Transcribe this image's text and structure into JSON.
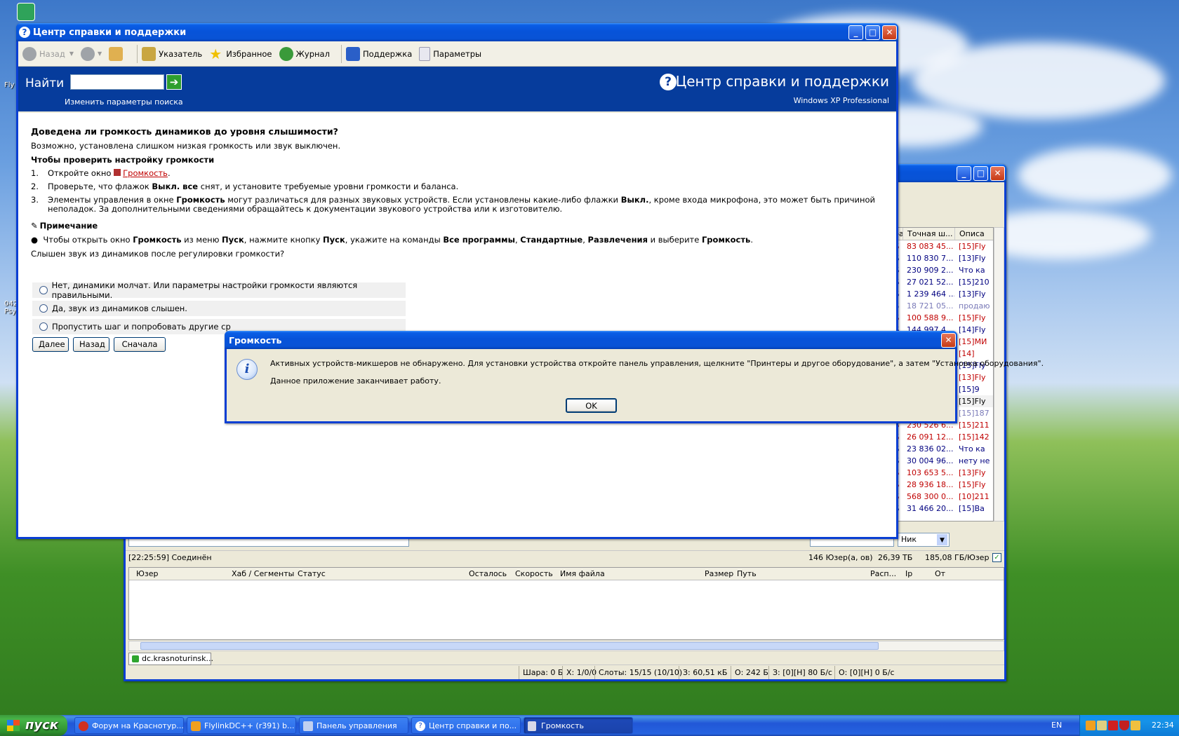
{
  "desktop": {
    "icons": [
      "Fly",
      "042\nPsy"
    ]
  },
  "help_window": {
    "title": "Центр справки и поддержки",
    "toolbar": {
      "back": "Назад",
      "index": "Указатель",
      "favorites": "Избранное",
      "history": "Журнал",
      "support": "Поддержка",
      "options": "Параметры"
    },
    "search": {
      "label": "Найти",
      "value": "",
      "change_params": "Изменить параметры поиска"
    },
    "banner": {
      "title": "Центр справки и поддержки",
      "subtitle": "Windows XP Professional"
    },
    "content": {
      "heading": "Доведена ли громкость динамиков до уровня слышимости?",
      "intro": "Возможно, установлена слишком низкая громкость или звук выключен.",
      "subheading": "Чтобы проверить настройку громкости",
      "step1_num": "1.",
      "step1_pre": "Откройте окно ",
      "step1_link": "Громкость",
      "step1_post": ".",
      "step2_num": "2.",
      "step2_pre": "Проверьте, что флажок ",
      "step2_bold": "Выкл. все",
      "step2_post": " снят, и установите требуемые уровни громкости и баланса.",
      "step3_num": "3.",
      "step3_a": "Элементы управления в окне ",
      "step3_b": "Громкость",
      "step3_c": " могут различаться для разных звуковых устройств. Если установлены какие-либо флажки ",
      "step3_d": "Выкл.",
      "step3_e": ", кроме входа микрофона, это может быть причиной неполадок. За дополнительными сведениями обращайтесь к документации звукового устройства или к изготовителю.",
      "note_title": "Примечание",
      "note_a": "Чтобы открыть окно ",
      "note_b": "Громкость",
      "note_c": " из меню ",
      "note_d": "Пуск",
      "note_e": ", нажмите кнопку ",
      "note_f": "Пуск",
      "note_g": ", укажите на команды ",
      "note_h": "Все программы",
      "note_i": ", ",
      "note_j": "Стандартные",
      "note_k": ", ",
      "note_l": "Развлечения",
      "note_m": " и выберите ",
      "note_n": "Громкость",
      "note_o": ".",
      "question": "Слышен звук из динамиков после регулировки громкости?",
      "options": [
        "Нет, динамики молчат. Или параметры настройки громкости являются правильными.",
        "Да, звук из динамиков слышен.",
        "Пропустить шаг и попробовать другие ср"
      ],
      "buttons": {
        "next": "Далее",
        "back": "Назад",
        "restart": "Сначала"
      }
    }
  },
  "dc_window": {
    "columns_top": [
      "ра",
      "Точная ш...",
      "Описа"
    ],
    "rows": [
      {
        "a": "Б",
        "b": "83 083 45...",
        "c": "[15]Fly",
        "color": "#c00000"
      },
      {
        "a": "Б",
        "b": "110 830 7...",
        "c": "[13]Fly",
        "color": "#000080"
      },
      {
        "a": "Б",
        "b": "230 909 2...",
        "c": "Что ка",
        "color": "#000080"
      },
      {
        "a": "Б",
        "b": "27 021 52...",
        "c": "[15]210",
        "color": "#000080"
      },
      {
        "a": "Б",
        "b": "1 239 464 ...",
        "c": "[13]Fly",
        "color": "#000080"
      },
      {
        "a": "Б",
        "b": "18 721 05...",
        "c": "продаю",
        "color": "#7a7ab8"
      },
      {
        "a": "Б",
        "b": "100 588 9...",
        "c": "[15]Fly",
        "color": "#c00000"
      },
      {
        "a": "Б",
        "b": "144 997 4...",
        "c": "[14]Fly",
        "color": "#000080"
      },
      {
        "a": "",
        "b": "",
        "c": "[15]МИ",
        "color": "#c00000"
      },
      {
        "a": "",
        "b": "",
        "c": "[14]",
        "color": "#c00000"
      },
      {
        "a": "",
        "b": "",
        "c": "[15]Fly",
        "color": "#000080"
      },
      {
        "a": "",
        "b": "",
        "c": "[13]Fly",
        "color": "#c00000"
      },
      {
        "a": "",
        "b": "",
        "c": "[15]9",
        "color": "#000080"
      },
      {
        "a": "",
        "b": "",
        "c": "[15]Fly",
        "color": "#000000"
      },
      {
        "a": "",
        "b": "",
        "c": "[15]187",
        "color": "#7a7ab8"
      },
      {
        "a": "Б",
        "b": "230 526 6...",
        "c": "[15]211",
        "color": "#c00000"
      },
      {
        "a": "Б",
        "b": "26 091 12...",
        "c": "[15]142",
        "color": "#c00000"
      },
      {
        "a": "Б",
        "b": "23 836 02...",
        "c": "Что ка",
        "color": "#000080"
      },
      {
        "a": "Б",
        "b": "30 004 96...",
        "c": "нету не",
        "color": "#000080"
      },
      {
        "a": "Б",
        "b": "103 653 5...",
        "c": "[13]Fly",
        "color": "#c00000"
      },
      {
        "a": "Б",
        "b": "28 936 18...",
        "c": "[15]Fly",
        "color": "#c00000"
      },
      {
        "a": "Б",
        "b": "568 300 0...",
        "c": "[10]211",
        "color": "#c00000"
      },
      {
        "a": "Б",
        "b": "31 466 20...",
        "c": "[15]Ва",
        "color": "#000080"
      }
    ],
    "nick_select": "Ник",
    "status_line": "[22:25:59] Соединён",
    "users": "146 Юзер(а, ов)",
    "share_total": "26,39 ТБ",
    "per_user": "185,08 ГБ/Юзер",
    "transfer_columns": [
      "Юзер",
      "Хаб / Сегменты",
      "Статус",
      "Осталось",
      "Скорость",
      "Имя файла",
      "Размер",
      "Путь",
      "Расп...",
      "Ip",
      "От"
    ],
    "hub_tab": "dc.krasnoturinsk...",
    "statusbar": [
      "Шара: 0 Б",
      "Х: 1/0/0",
      "Слоты: 15/15 (10/10)",
      "З: 60,51 кБ",
      "О: 242 Б",
      "З: [0][Н] 80 Б/с",
      "О: [0][Н] 0 Б/с"
    ]
  },
  "dialog": {
    "title": "Громкость",
    "message": "Активных устройств-микшеров не обнаружено. Для установки устройства откройте панель управления, щелкните \"Принтеры и другое оборудование\", а затем \"Установка оборудования\".",
    "message2": "Данное приложение заканчивает работу.",
    "ok": "OK"
  },
  "taskbar": {
    "start": "пуск",
    "tasks": [
      "Форум на Краснотур...",
      "FlylinkDC++ (r391) b...",
      "Панель управления",
      "Центр справки и по...",
      "Громкость"
    ],
    "lang": "EN",
    "clock": "22:34"
  }
}
